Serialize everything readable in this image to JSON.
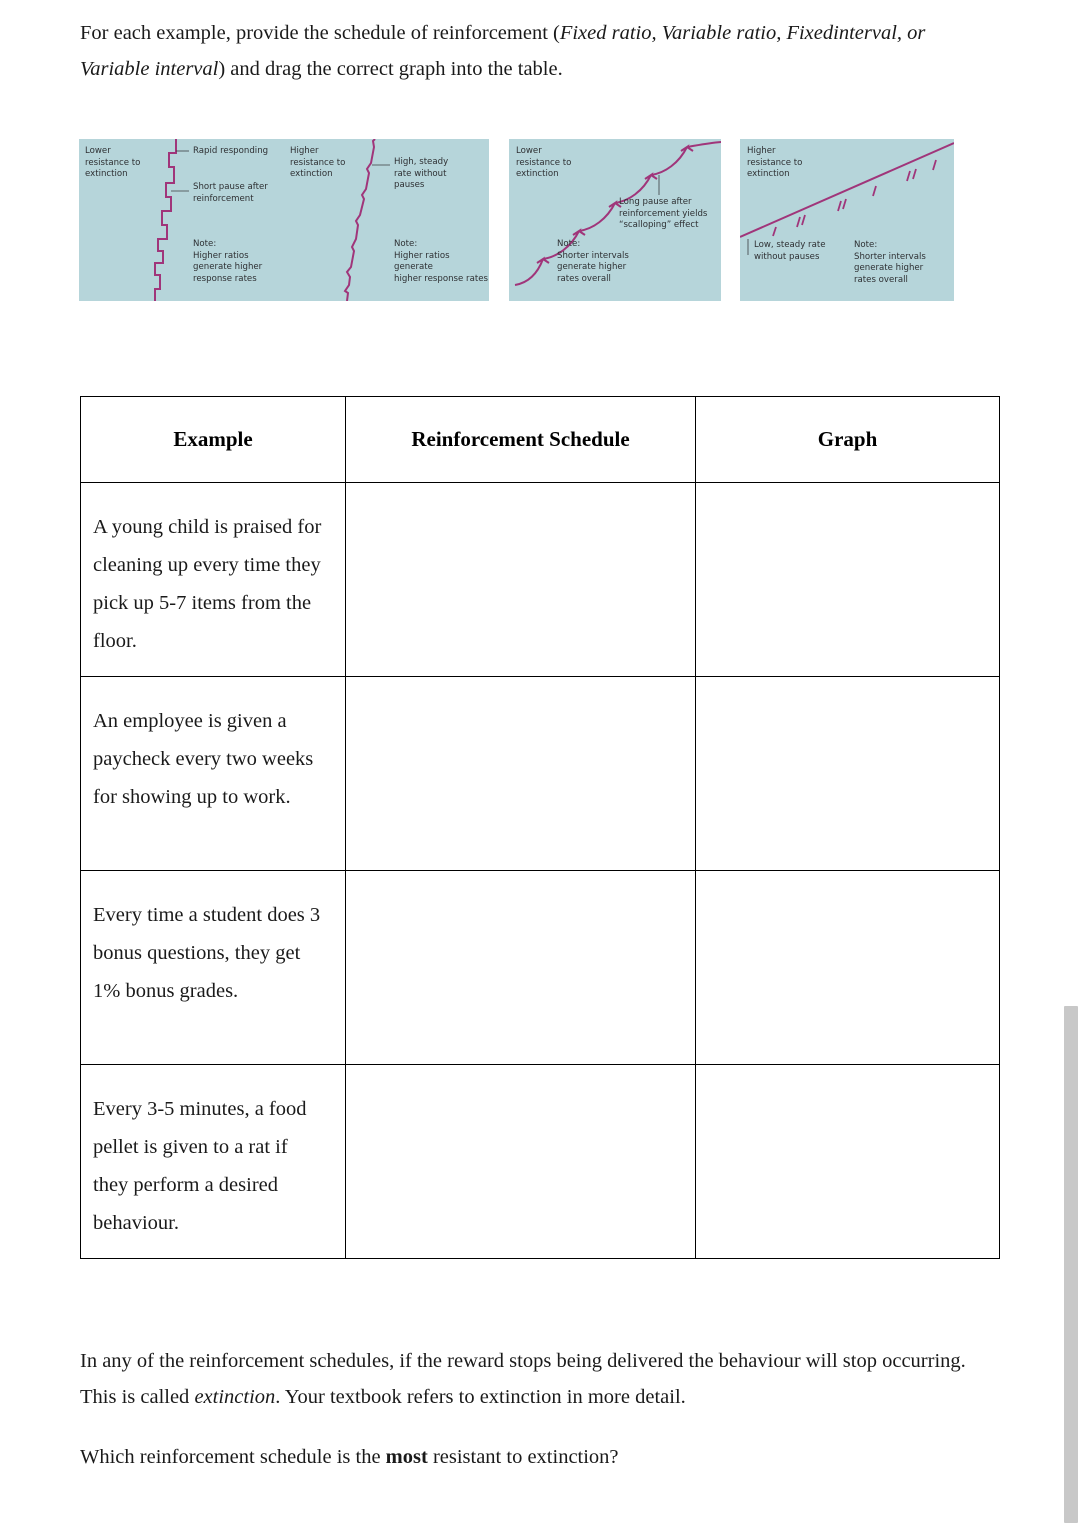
{
  "intro": {
    "line_a": "For each example, provide the schedule of reinforcement (",
    "italic_a": "Fixed ratio, Variable ratio, Fixed",
    "italic_b": "interval, or Variable interval",
    "line_b": ") and drag the correct graph into the table."
  },
  "graphs": {
    "panel1": {
      "name": "fixed-ratio-graph",
      "resistance": "Lower\nresistance to\nextinction",
      "callout1": "Rapid responding",
      "callout2": "Short pause after\nreinforcement",
      "note": "Note:\nHigher ratios\ngenerate higher\nresponse rates"
    },
    "panel2": {
      "name": "variable-ratio-graph",
      "resistance": "Higher\nresistance to\nextinction",
      "callout1": "High, steady\nrate without\npauses",
      "note": "Note:\nHigher ratios generate\nhigher response rates"
    },
    "panel3": {
      "name": "fixed-interval-graph",
      "resistance": "Lower\nresistance to\nextinction",
      "callout1": "Long pause after\nreinforcement yields\n“scalloping” effect",
      "note": "Note:\nShorter intervals\ngenerate higher\nrates overall"
    },
    "panel4": {
      "name": "variable-interval-graph",
      "resistance": "Higher\nresistance to\nextinction",
      "callout1": "Low, steady rate\nwithout pauses",
      "note": "Note:\nShorter intervals\ngenerate higher\nrates overall"
    },
    "panel_bg_color": "#b6d5da",
    "line_color": "#a0357a"
  },
  "table": {
    "headers": [
      "Example",
      "Reinforcement Schedule",
      "Graph"
    ],
    "rows": [
      {
        "example": "A young child is praised for cleaning up every time they pick up 5-7 items from the floor.",
        "schedule": "",
        "graph": ""
      },
      {
        "example": "An employee is given a paycheck every two weeks for showing up to work.",
        "schedule": "",
        "graph": ""
      },
      {
        "example": "Every time a student does 3 bonus questions, they get 1% bonus grades.",
        "schedule": "",
        "graph": ""
      },
      {
        "example": "Every 3-5 minutes, a food pellet is given to a rat if they perform a desired behaviour.",
        "schedule": "",
        "graph": ""
      }
    ]
  },
  "outro": {
    "p1_part1": "In any of the reinforcement schedules, if the reward stops being delivered the behaviour will stop occurring. This is called ",
    "p1_italic": "extinction",
    "p1_part2": ". Your textbook refers to extinction in more detail.",
    "p2_part1": "Which reinforcement schedule is the ",
    "p2_bold": "most",
    "p2_part2": " resistant to extinction?"
  }
}
